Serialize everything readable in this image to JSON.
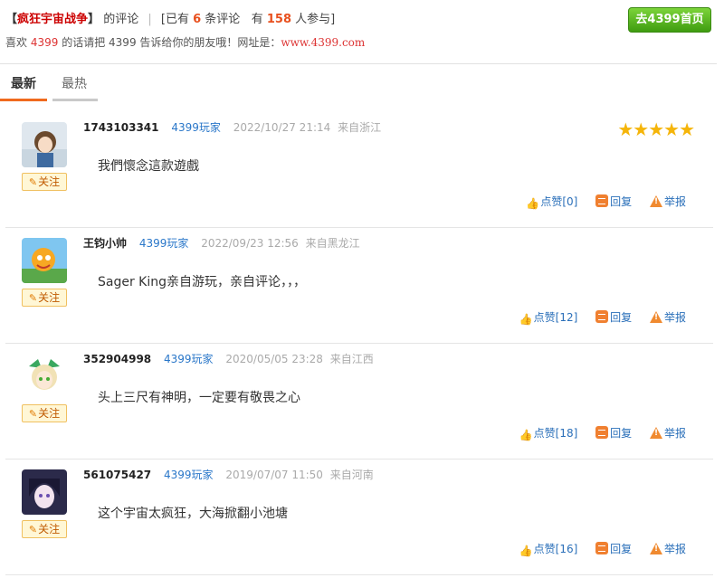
{
  "header": {
    "prefix_bracket_open": "【",
    "game_name": "疯狂宇宙战争",
    "prefix_bracket_close": "】",
    "suffix": "的评论",
    "sep": "|",
    "stats_open": "[已有",
    "comment_count": "6",
    "comment_word": "条评论",
    "have": "有",
    "participant_count": "158",
    "participant_word": "人参与]",
    "sub_part1": "喜欢",
    "sub_brand": "4399",
    "sub_part2": "的话请把 4399 告诉给你的朋友哦！网址是：",
    "sub_url": "www.4399.com",
    "home_button": "去4399首页"
  },
  "tabs": [
    {
      "label": "最新",
      "active": true
    },
    {
      "label": "最热",
      "active": false
    }
  ],
  "colors": {
    "accent": "#f06a1e",
    "link": "#2a77c9",
    "star": "#f5b50a",
    "green": "#4caf1a"
  },
  "comments": [
    {
      "user": "1743103341",
      "role": "4399玩家",
      "time": "2022/10/27 21:14",
      "location": "来自浙江",
      "content": "我們懷念這款遊戲",
      "rating": 5,
      "follow": "关注",
      "like": "点赞[0]",
      "reply": "回复",
      "report": "举报"
    },
    {
      "user": "王钧小帅",
      "role": "4399玩家",
      "time": "2022/09/23 12:56",
      "location": "来自黑龙江",
      "content": "Sager King亲自游玩，亲自评论，，，",
      "follow": "关注",
      "like": "点赞[12]",
      "reply": "回复",
      "report": "举报"
    },
    {
      "user": "352904998",
      "role": "4399玩家",
      "time": "2020/05/05 23:28",
      "location": "来自江西",
      "content": "头上三尺有神明，一定要有敬畏之心",
      "follow": "关注",
      "like": "点赞[18]",
      "reply": "回复",
      "report": "举报"
    },
    {
      "user": "561075427",
      "role": "4399玩家",
      "time": "2019/07/07 11:50",
      "location": "来自河南",
      "content": "这个宇宙太疯狂，大海掀翻小池塘",
      "follow": "关注",
      "like": "点赞[16]",
      "reply": "回复",
      "report": "举报"
    }
  ]
}
